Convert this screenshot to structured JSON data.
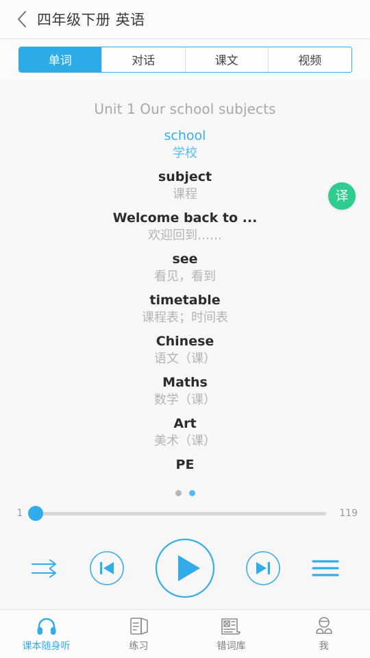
{
  "header": {
    "back_icon": "chevron-left-icon",
    "title": "四年级下册 英语"
  },
  "tabs": [
    {
      "label": "单词",
      "active": true
    },
    {
      "label": "对话",
      "active": false
    },
    {
      "label": "课文",
      "active": false
    },
    {
      "label": "视频",
      "active": false
    }
  ],
  "content": {
    "translate_button": {
      "label": "译",
      "icon": "translate-icon",
      "color": "#2ecc8f"
    },
    "unit_title": "Unit 1 Our school subjects",
    "words": [
      {
        "en": "school",
        "cn": "学校",
        "active": true
      },
      {
        "en": "subject",
        "cn": "课程",
        "active": false
      },
      {
        "en": "Welcome back to ...",
        "cn": "欢迎回到……",
        "active": false
      },
      {
        "en": "see",
        "cn": "看见，看到",
        "active": false
      },
      {
        "en": "timetable",
        "cn": "课程表；时间表",
        "active": false
      },
      {
        "en": "Chinese",
        "cn": "语文（课）",
        "active": false
      },
      {
        "en": "Maths",
        "cn": "数学（课）",
        "active": false
      },
      {
        "en": "Art",
        "cn": "美术（课）",
        "active": false
      },
      {
        "en": "PE",
        "cn": "",
        "active": false
      }
    ]
  },
  "pager": {
    "dots": [
      {
        "active": false
      },
      {
        "active": true
      }
    ]
  },
  "slider": {
    "current_label": "1",
    "total_label": "119",
    "value": 1,
    "min": 1,
    "max": 119,
    "fill_percent": 0
  },
  "controls": [
    {
      "name": "play-mode-sequential-button",
      "icon": "double-arrow-right-icon"
    },
    {
      "name": "previous-button",
      "icon": "skip-previous-icon"
    },
    {
      "name": "play-button",
      "icon": "play-icon"
    },
    {
      "name": "next-button",
      "icon": "skip-next-icon"
    },
    {
      "name": "playlist-button",
      "icon": "hamburger-list-icon"
    }
  ],
  "bottom_nav": [
    {
      "label": "课本随身听",
      "icon": "headphones-icon",
      "active": true
    },
    {
      "label": "练习",
      "icon": "book-icon",
      "active": false
    },
    {
      "label": "错词库",
      "icon": "wrong-words-icon",
      "active": false
    },
    {
      "label": "我",
      "icon": "person-icon",
      "active": false
    }
  ],
  "theme": {
    "accent": "#2dabe8",
    "accent_light": "#58bdf0",
    "green": "#2ecc8f",
    "muted": "#b4b4b4",
    "background": "#f7f7f7"
  }
}
